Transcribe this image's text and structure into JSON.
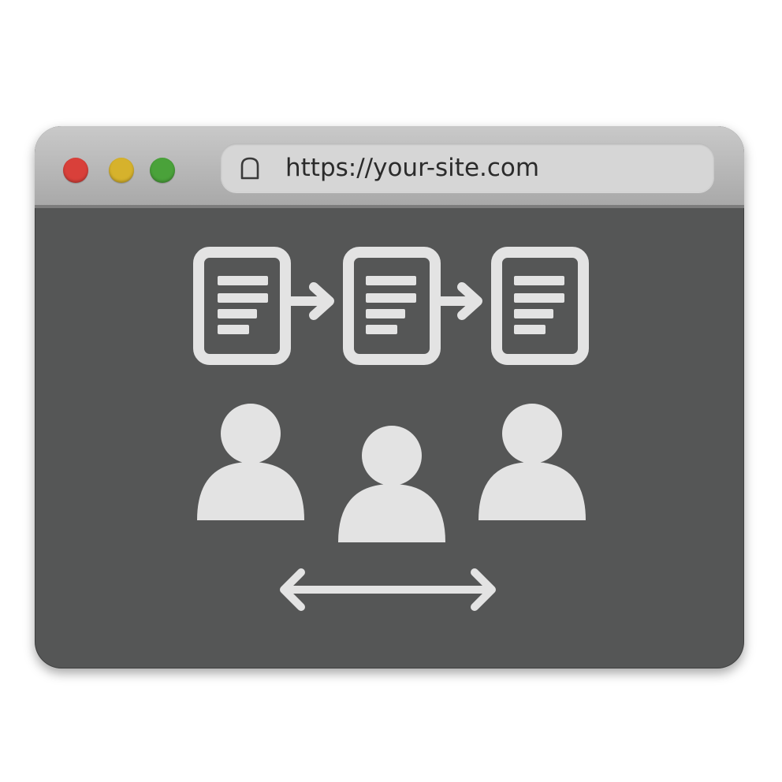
{
  "window": {
    "traffic_lights": [
      {
        "name": "close",
        "color": "#d9403a"
      },
      {
        "name": "minimize",
        "color": "#d6b22c"
      },
      {
        "name": "zoom",
        "color": "#4aa23a"
      }
    ],
    "address_bar": {
      "icon": "lock-icon",
      "url": "https://your-site.com"
    }
  },
  "content": {
    "icons": [
      "document-icon",
      "arrow-right-icon",
      "document-icon",
      "arrow-right-icon",
      "document-icon",
      "user-icon",
      "user-icon",
      "user-icon",
      "double-arrow-icon"
    ],
    "colors": {
      "window_body": "#555656",
      "icon_fill": "#e3e3e3",
      "title_bar": "#bdbdbd"
    }
  }
}
